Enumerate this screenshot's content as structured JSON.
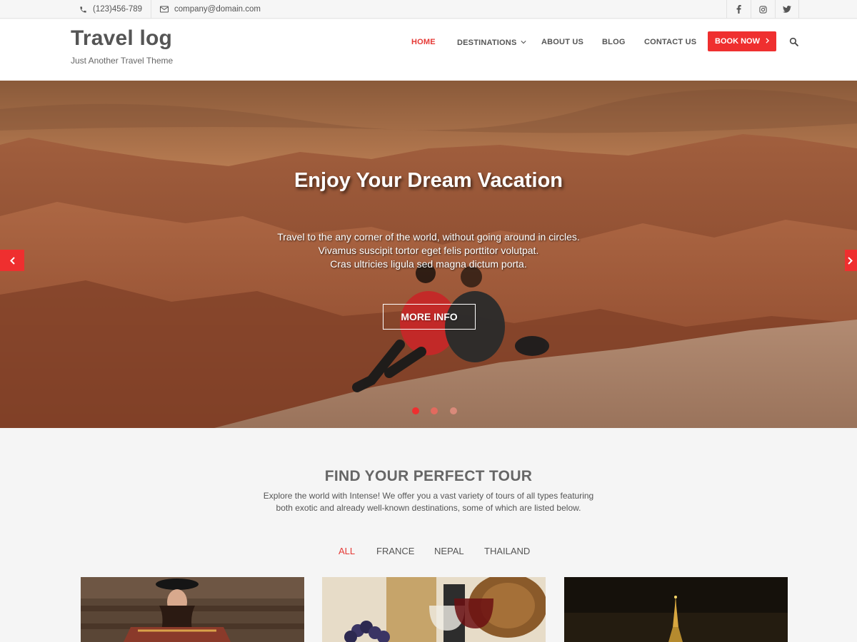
{
  "topbar": {
    "phone": "(123)456-789",
    "email": "company@domain.com",
    "social": [
      "facebook-icon",
      "instagram-icon",
      "twitter-icon"
    ]
  },
  "header": {
    "title": "Travel log",
    "tagline": "Just Another Travel Theme",
    "nav": {
      "home": "HOME",
      "destinations": "DESTINATIONS",
      "about": "ABOUT US",
      "blog": "BLOG",
      "contact": "CONTACT US"
    },
    "book_label": "BOOK NOW"
  },
  "hero": {
    "title": "Enjoy Your Dream Vacation",
    "line1": "Travel to the any corner of the world, without going around in circles.",
    "line2": "Vivamus suscipit tortor eget felis porttitor volutpat.",
    "line3": "Cras ultricies ligula sed magna dictum porta.",
    "button": "MORE INFO",
    "active_slide": 1,
    "slide_count": 3
  },
  "tours": {
    "title": "FIND YOUR PERFECT TOUR",
    "desc1": "Explore the world with Intense! We offer you a vast variety of tours of all types featuring",
    "desc2": "both exotic and already well-known destinations, some of which are listed below.",
    "filters": {
      "all": "ALL",
      "france": "FRANCE",
      "nepal": "NEPAL",
      "thailand": "THAILAND"
    }
  },
  "colors": {
    "accent": "#ef2f2f",
    "text": "#555555"
  }
}
